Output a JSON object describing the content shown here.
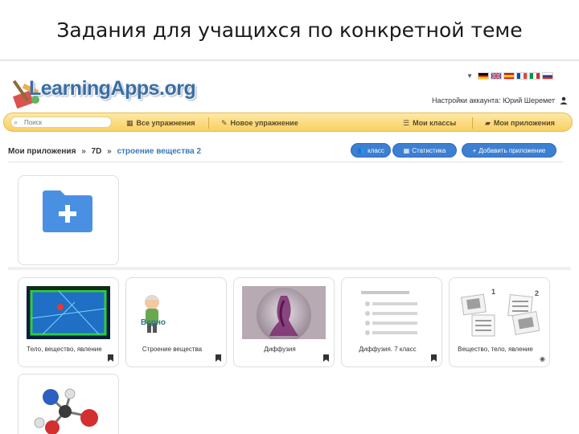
{
  "slide": {
    "title": "Задания для учащихся по конкретной теме"
  },
  "header": {
    "logo": "LearningApps.org",
    "account_label": "Настройки аккаунта: Юрий Шеремет",
    "languages": [
      "de-flag-icon",
      "uk-flag-icon",
      "es-flag-icon",
      "fr-flag-icon",
      "it-flag-icon",
      "ru-flag-icon"
    ]
  },
  "toolbar": {
    "search_placeholder": "Поиск",
    "all_exercises": "Все упражнения",
    "new_exercise": "Новое упражнение",
    "my_classes": "Мои классы",
    "my_apps": "Мои приложения"
  },
  "breadcrumb": {
    "root": "Мои приложения",
    "folder": "7D",
    "current": "строение вещества 2",
    "separator": "»"
  },
  "actions": {
    "class": "класс",
    "statistics": "Статистика",
    "add_app": "Добавить приложение"
  },
  "cards": [
    {
      "title": "Тело, вещество, явление",
      "thumb": "game-board-thumb"
    },
    {
      "title": "Строение вещества",
      "thumb": "professor-thumb",
      "thumb_text": "Верно"
    },
    {
      "title": "Диффузия",
      "thumb": "diffusion-photo-thumb"
    },
    {
      "title": "Диффузия. 7 класс",
      "thumb": "text-list-thumb"
    },
    {
      "title": "Вещество, тело, явление",
      "thumb": "matching-thumb",
      "badges": [
        "1",
        "2"
      ]
    }
  ],
  "colors": {
    "accent_blue": "#3d7fd1",
    "toolbar_yellow": "#f9cf62",
    "folder_blue": "#4a90e2"
  }
}
